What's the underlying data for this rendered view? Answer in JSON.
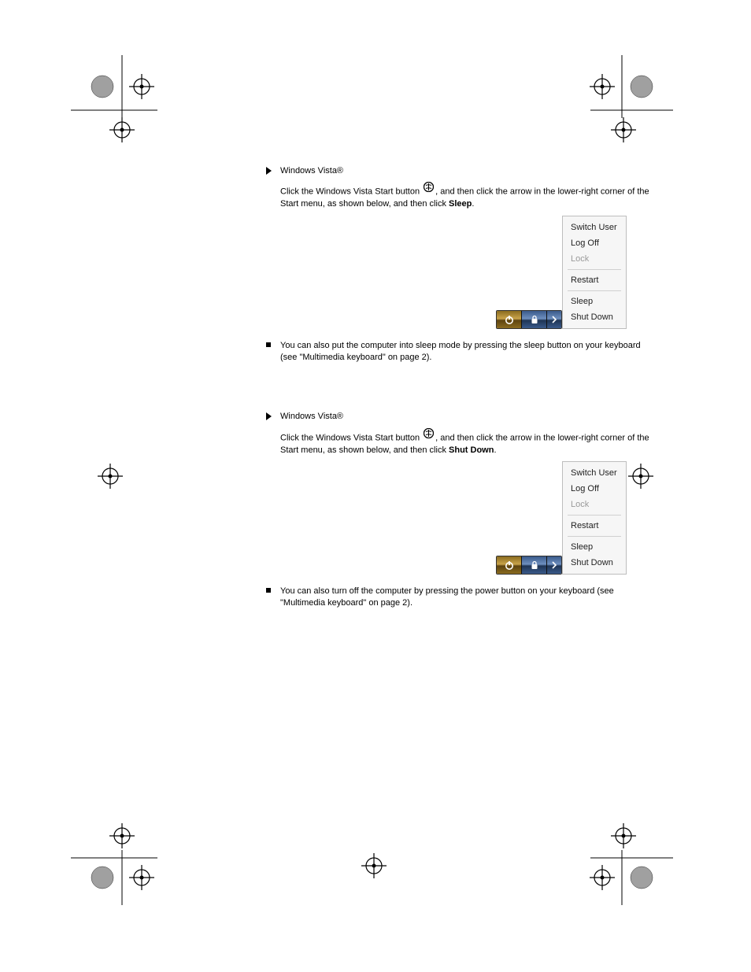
{
  "sections": [
    {
      "intro_text": "Windows Vista®",
      "instruction_text": "Click the Windows Vista Start button , and then click the arrow in the lower-right corner of the Start menu, as shown below, and then click ",
      "action": "Sleep",
      "period": ".",
      "note_text": "You can also put the computer into sleep mode by pressing the sleep button on your keyboard (see \"Multimedia keyboard\" on page 2)."
    },
    {
      "intro_text": "Windows Vista®",
      "instruction_text": "Click the Windows Vista Start button , and then click the arrow in the lower-right corner of the Start menu, as shown below, and then click ",
      "action": "Shut Down",
      "period": ".",
      "note_text": "You can also turn off the computer by pressing the power button on your keyboard (see \"Multimedia keyboard\" on page 2)."
    }
  ],
  "menu": {
    "items": [
      "Switch User",
      "Log Off",
      "Lock",
      "Restart",
      "Sleep",
      "Shut Down"
    ],
    "disabled_index": 2,
    "rule_after": [
      2,
      3
    ]
  }
}
